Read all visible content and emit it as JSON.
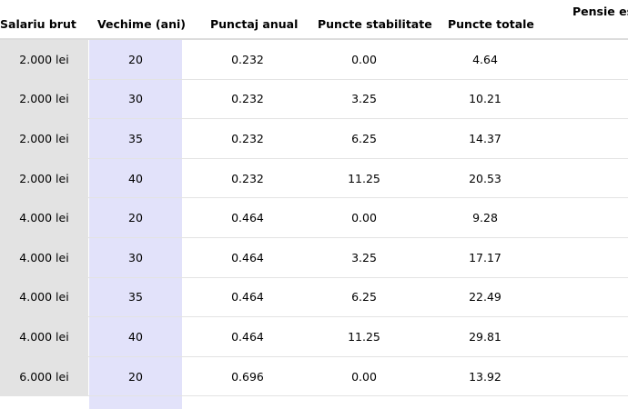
{
  "columns": [
    "Salariu brut",
    "Vechime (ani)",
    "Punctaj anual",
    "Puncte stabilitate",
    "Puncte totale",
    "Pensie est"
  ],
  "rows": [
    [
      "2.000 lei",
      "20",
      "0.232",
      "0.00",
      "4.64",
      ""
    ],
    [
      "2.000 lei",
      "30",
      "0.232",
      "3.25",
      "10.21",
      ""
    ],
    [
      "2.000 lei",
      "35",
      "0.232",
      "6.25",
      "14.37",
      ""
    ],
    [
      "2.000 lei",
      "40",
      "0.232",
      "11.25",
      "20.53",
      ""
    ],
    [
      "4.000 lei",
      "20",
      "0.464",
      "0.00",
      "9.28",
      ""
    ],
    [
      "4.000 lei",
      "30",
      "0.464",
      "3.25",
      "17.17",
      ""
    ],
    [
      "4.000 lei",
      "35",
      "0.464",
      "6.25",
      "22.49",
      ""
    ],
    [
      "4.000 lei",
      "40",
      "0.464",
      "11.25",
      "29.81",
      ""
    ],
    [
      "6.000 lei",
      "20",
      "0.696",
      "0.00",
      "13.92",
      ""
    ]
  ],
  "colors": {
    "salary_column_bg": "#e3e3e3",
    "seniority_column_bg": "#e2e2fa",
    "header_border": "#dcdcdc",
    "row_border": "#e3e3e3"
  }
}
